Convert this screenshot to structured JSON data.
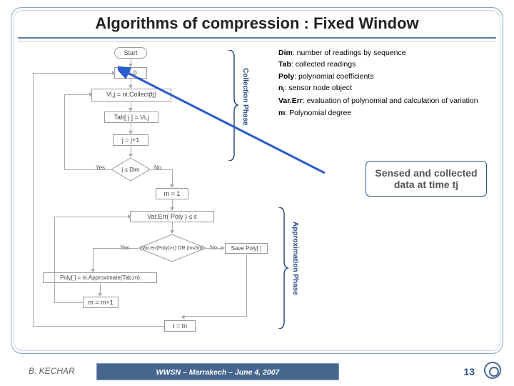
{
  "title": "Algorithms of compression : Fixed Window",
  "legend": {
    "dim_t": "Dim",
    "dim_d": ": number of readings by sequence",
    "tab_t": "Tab",
    "tab_d": ": collected readings",
    "poly_t": "Poly",
    "poly_d": ": polynomial coefficients",
    "ni_t": "n",
    "ni_sub": "i",
    "ni_d": ": sensor node object",
    "var_t": "Var.Err",
    "var_d": ": evaluation of polynomial and calculation of variation",
    "m_t": "m",
    "m_d": ": Polynomial degree"
  },
  "sensed_box": "Sensed and collected data at time tj",
  "flow": {
    "start": "Start",
    "j0": "j = 0",
    "collect": "Vi,j = ni.Collect(tj)",
    "tab": "Tab[ j ] = Vi,j",
    "jpp": "j = j+1",
    "cond1": "j ≤ Dim",
    "yes": "Yes",
    "no": "No",
    "m1": "m = 1",
    "verr": "Var.Err( Poly ) ≤ ε",
    "cond2": "(Var.err(Poly)>ε) OR (m≤5m)",
    "approx": "Poly[ ] = ni.Approximate(Tab,m)",
    "savepoly": "Save Poly[ ]",
    "mpp": "m = m+1",
    "tn": "t = tn"
  },
  "phase1": "Collection Phase",
  "phase2": "Approximation Phase",
  "footer": {
    "author": "B. KECHAR",
    "event": "WWSN – Marrakech – June 4, 2007",
    "page": "13"
  }
}
